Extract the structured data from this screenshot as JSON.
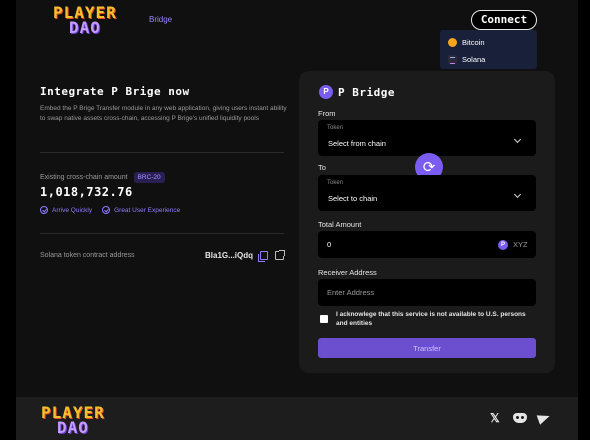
{
  "header": {
    "logo_line1": "PLAYER",
    "logo_line2": "DAO",
    "nav_bridge": "Bridge",
    "connect_label": "Connect",
    "connect_menu": [
      {
        "label": "Bitcoin",
        "icon": "bitcoin-icon"
      },
      {
        "label": "Solana",
        "icon": "solana-icon"
      }
    ]
  },
  "intro": {
    "title": "Integrate P Brige now",
    "description": "Embed the P Brige Transfer module in any web application, giving users instant ability to swap native assets cross-chain, accessing P Brige's unified liquidity pools"
  },
  "stats": {
    "existing_label": "Existing cross-chain amount",
    "badge": "BRC-20",
    "amount": "1,018,732.76",
    "features": [
      "Arrive Quickly",
      "Great User Experience"
    ]
  },
  "contract": {
    "label": "Solana token contract address",
    "value": "Bla1G...iQdq"
  },
  "bridge": {
    "logo_letter": "P",
    "title": "P Bridge",
    "from_label": "From",
    "from_sub": "Token",
    "from_value": "Select from chain",
    "to_label": "To",
    "to_sub": "Token",
    "to_value": "Select to chain",
    "total_label": "Total Amount",
    "total_value": "0",
    "token_symbol": "XYZ",
    "token_icon_letter": "P",
    "receiver_label": "Receiver Address",
    "receiver_placeholder": "Enter Address",
    "ack_text": "I acknowlege that this service is not available to U.S. persons and entities",
    "transfer_label": "Transfer",
    "swap_glyph": "⟳"
  },
  "footer": {
    "logo_line1": "PLAYER",
    "logo_line2": "DAO",
    "x_glyph": "𝕏"
  },
  "colors": {
    "accent": "#7b5cf0",
    "button": "#6b4fcf",
    "logo_yellow": "#f2c12e",
    "logo_purple": "#c59bff"
  }
}
